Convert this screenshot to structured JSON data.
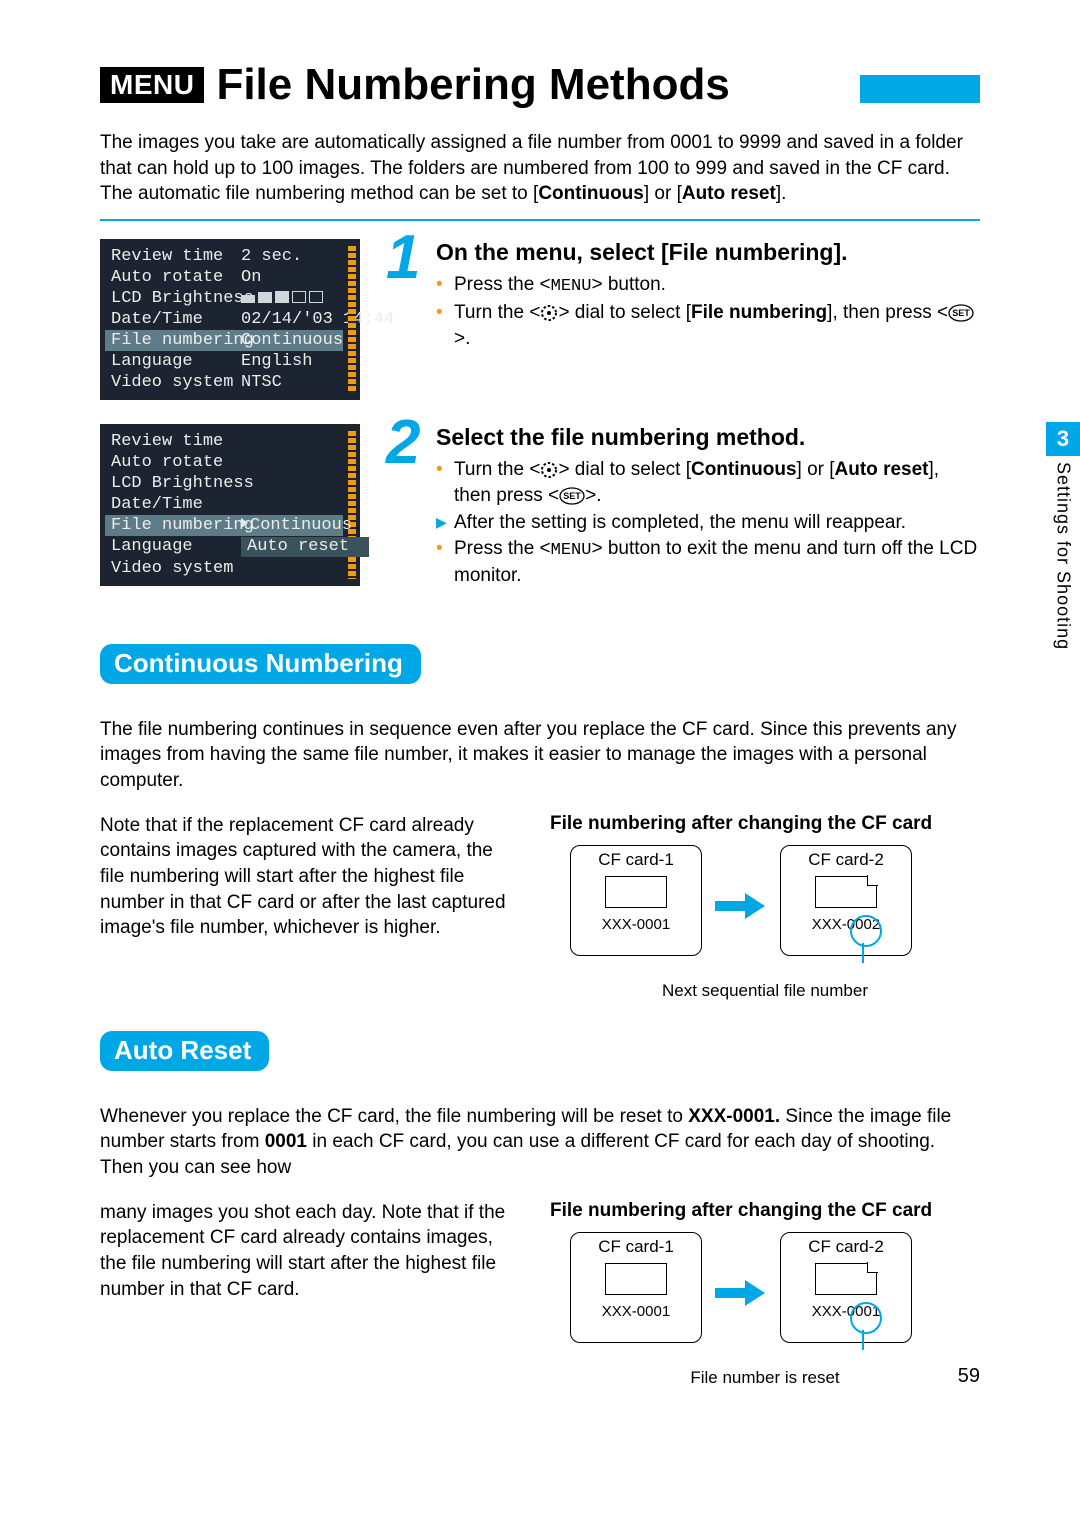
{
  "badge": "MENU",
  "title": "File Numbering Methods",
  "intro_prefix": "The images you take are automatically assigned a file number from 0001 to 9999 and saved in a folder that can hold up to 100 images. The folders are numbered from 100 to 999 and saved in the CF card. The automatic file numbering method can be set to [",
  "intro_bold1": "Continuous",
  "intro_mid": "] or [",
  "intro_bold2": "Auto reset",
  "intro_suffix": "].",
  "lcd1": {
    "rows": [
      {
        "k": "Review time",
        "v": "2 sec."
      },
      {
        "k": "Auto rotate",
        "v": "On"
      },
      {
        "k": "LCD Brightness",
        "v": ""
      },
      {
        "k": "Date/Time",
        "v": "02/14/'03 14:44"
      },
      {
        "k": "File numbering",
        "v": "Continuous"
      },
      {
        "k": "Language",
        "v": "English"
      },
      {
        "k": "Video system",
        "v": "NTSC"
      }
    ],
    "selected_index": 4
  },
  "lcd2": {
    "rows": [
      {
        "k": "Review time",
        "v": ""
      },
      {
        "k": "Auto rotate",
        "v": ""
      },
      {
        "k": "LCD Brightness",
        "v": ""
      },
      {
        "k": "Date/Time",
        "v": ""
      },
      {
        "k": "File numbering",
        "v": "Continuous"
      },
      {
        "k": "Language",
        "v": "Auto reset"
      },
      {
        "k": "Video system",
        "v": ""
      }
    ],
    "selected_index": 4
  },
  "step1": {
    "num": "1",
    "title": "On the menu, select [File numbering].",
    "b1_pre": "Press the <",
    "b1_ctrl": "MENU",
    "b1_post": "> button.",
    "b2_pre": "Turn the <",
    "b2_mid1": "> dial to select [",
    "b2_bold": "File numbering",
    "b2_mid2": "], then press <",
    "b2_post": ">."
  },
  "step2": {
    "num": "2",
    "title": "Select the file numbering method.",
    "b1_pre": "Turn the <",
    "b1_mid1": "> dial to select [",
    "b1_bold1": "Continuous",
    "b1_mid2": "] or [",
    "b1_bold2": "Auto reset",
    "b1_mid3": "], then press <",
    "b1_post": ">.",
    "b2": "After the setting is completed, the menu will reappear.",
    "b3_pre": "Press the <",
    "b3_ctrl": "MENU",
    "b3_post": "> button to exit the menu and turn off the LCD monitor."
  },
  "sectionA": {
    "pill": "Continuous Numbering",
    "p1": "The file numbering continues in sequence even after you replace the CF card. Since this prevents any images from having the same file number, it makes it easier to manage the images with a personal computer.",
    "p2": "Note that if the replacement CF card already contains images captured with the camera, the file numbering will start after the highest file number in that CF card or after the last captured image's file number, whichever is higher.",
    "card_title": "File numbering after changing the CF card",
    "cf1_label": "CF card-1",
    "cf2_label": "CF card-2",
    "cf1_fn": "XXX-0001",
    "cf2_fn": "XXX-0002",
    "caption": "Next sequential file number"
  },
  "sectionB": {
    "pill": "Auto Reset",
    "p1_pre": "Whenever you replace the CF card, the file numbering will be reset to ",
    "p1_b1": "XXX-0001.",
    "p1_mid": " Since the image file number starts from ",
    "p1_b2": "0001",
    "p1_post": " in each CF card, you can use a different CF card for each day of shooting. Then you can see how",
    "p2": "many images you shot each day. Note that if the replacement CF card already contains images, the file numbering will start after the highest file number in that CF card.",
    "card_title": "File numbering after changing the CF card",
    "cf1_label": "CF card-1",
    "cf2_label": "CF card-2",
    "cf1_fn": "XXX-0001",
    "cf2_fn": "XXX-0001",
    "caption": "File number is reset"
  },
  "side": {
    "chapter": "3",
    "label": "Settings for Shooting"
  },
  "page_number": "59"
}
